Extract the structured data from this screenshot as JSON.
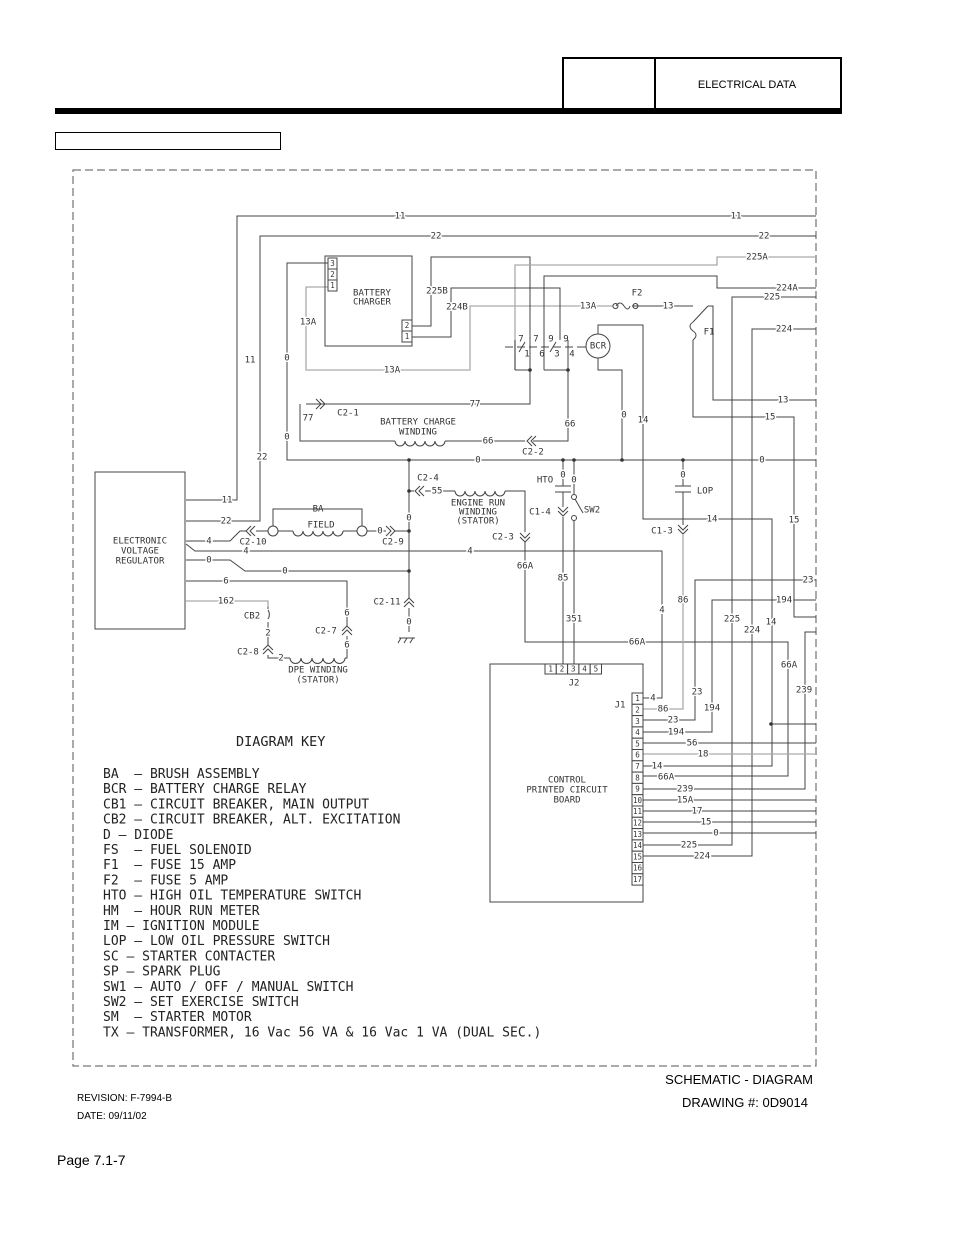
{
  "header": {
    "section": "ELECTRICAL DATA",
    "box_label": ""
  },
  "schematic": {
    "wire_numbers": [
      "11",
      "11",
      "11",
      "11",
      "22",
      "22",
      "22",
      "22",
      "225A",
      "224A",
      "225",
      "224",
      "13",
      "15",
      "15",
      "225B",
      "224B",
      "13A",
      "13",
      "13A",
      "13A",
      "0",
      "0",
      "77",
      "77",
      "66",
      "66",
      "0",
      "0",
      "0",
      "14",
      "4",
      "4",
      "4",
      "0",
      "0",
      "6",
      "162",
      "0",
      "0",
      "55",
      "6",
      "6",
      "2",
      "2",
      "0",
      "0",
      "0",
      "0",
      "14",
      "66A",
      "85",
      "351",
      "86",
      "4",
      "23",
      "194",
      "225",
      "224",
      "14",
      "66A",
      "66A",
      "239",
      "23",
      "194",
      "4",
      "86",
      "23",
      "194",
      "56",
      "18",
      "14",
      "66A",
      "239",
      "15A",
      "17",
      "15",
      "0",
      "225",
      "224"
    ],
    "component_labels": [
      "BATTERY",
      "CHARGER",
      "F2",
      "F1",
      "BCR",
      "C2-1",
      "BATTERY CHARGE",
      "WINDING",
      "C2-2",
      "C2-4",
      "ENGINE RUN",
      "WINDING",
      "(STATOR)",
      "HTO",
      "C1-4",
      "SW2",
      "C2-3",
      "LOP",
      "C1-3",
      "FIELD",
      "BA",
      "C2-10",
      "C2-9",
      "C2-11",
      "CB2",
      "C2-7",
      "C2-8",
      "DPE WINDING",
      "(STATOR)",
      "ELECTRONIC",
      "VOLTAGE",
      "REGULATOR",
      "J2",
      "J1",
      "CONTROL",
      "PRINTED CIRCUIT",
      "BOARD"
    ],
    "relay_contacts_top": [
      "7",
      "7",
      "9",
      "9"
    ],
    "relay_contacts_bottom": [
      "1",
      "6",
      "3",
      "4"
    ],
    "charger_pins_left": [
      "3",
      "2",
      "1"
    ],
    "charger_pins_right": [
      "2",
      "1"
    ],
    "j2_pins": [
      "1",
      "2",
      "3",
      "4",
      "5"
    ],
    "j1_pins": [
      "1",
      "2",
      "3",
      "4",
      "5",
      "6",
      "7",
      "8",
      "9",
      "10",
      "11",
      "12",
      "13",
      "14",
      "15",
      "16",
      "17"
    ]
  },
  "diagram_key": {
    "title": "DIAGRAM KEY",
    "items": [
      "BA  – BRUSH ASSEMBLY",
      "BCR – BATTERY CHARGE RELAY",
      "CB1 – CIRCUIT BREAKER, MAIN OUTPUT",
      "CB2 – CIRCUIT BREAKER, ALT. EXCITATION",
      "D – DIODE",
      "FS  – FUEL SOLENOID",
      "F1  – FUSE 15 AMP",
      "F2  – FUSE 5 AMP",
      "HTO – HIGH OIL TEMPERATURE SWITCH",
      "HM  – HOUR RUN METER",
      "IM – IGNITION MODULE",
      "LOP – LOW OIL PRESSURE SWITCH",
      "SC – STARTER CONTACTER",
      "SP – SPARK PLUG",
      "SW1 – AUTO / OFF / MANUAL SWITCH",
      "SW2 – SET EXERCISE SWITCH",
      "SM  – STARTER MOTOR",
      "TX – TRANSFORMER, 16 Vac 56 VA & 16 Vac 1 VA (DUAL SEC.)"
    ]
  },
  "footer": {
    "title": "SCHEMATIC - DIAGRAM",
    "drawing": "DRAWING #: 0D9014",
    "revision": "REVISION: F-7994-B",
    "date": "DATE: 09/11/02",
    "page": "Page 7.1-7"
  }
}
